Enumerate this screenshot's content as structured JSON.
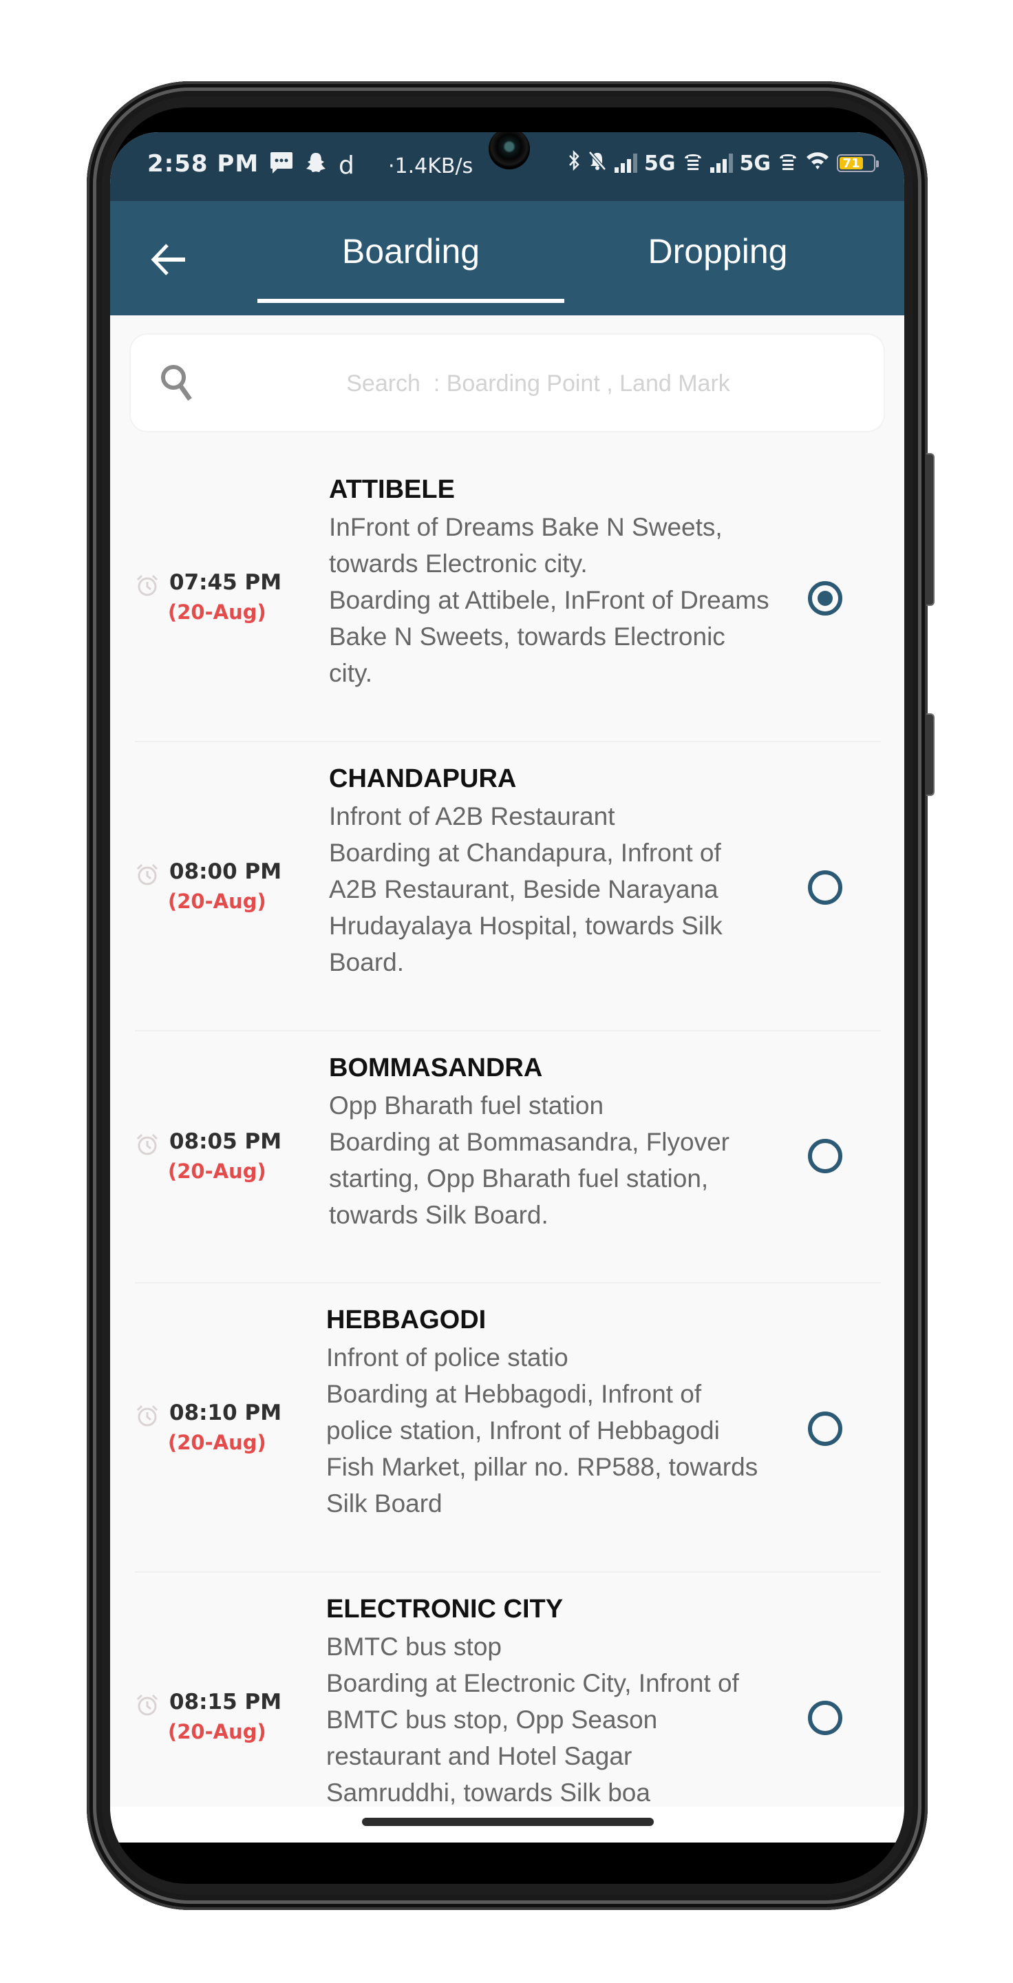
{
  "status_bar": {
    "time": "2:58 PM",
    "net_speed": "·1.4KB/s",
    "network_1": "5G",
    "network_2": "5G",
    "battery": "71",
    "icons": [
      "message-icon",
      "snapchat-icon",
      "d-app-icon",
      "bluetooth-icon",
      "mute-icon",
      "signal-icon",
      "volte-icon",
      "signal-icon",
      "volte-icon",
      "wifi-icon",
      "battery-icon"
    ]
  },
  "header": {
    "back_icon": "arrow-left-icon",
    "tabs": [
      {
        "label": "Boarding",
        "active": true
      },
      {
        "label": "Dropping",
        "active": false
      }
    ]
  },
  "search": {
    "icon": "search-icon",
    "placeholder": "Search  : Boarding Point , Land Mark",
    "value": ""
  },
  "points": [
    {
      "name": "ATTIBELE",
      "time": "07:45 PM",
      "date": "(20-Aug)",
      "address": "InFront of Dreams Bake N Sweets, towards Electronic city.",
      "details": "Boarding at Attibele, InFront of Dreams Bake N Sweets, towards Electronic city.",
      "selected": true
    },
    {
      "name": "CHANDAPURA",
      "time": "08:00 PM",
      "date": "(20-Aug)",
      "address": "Infront of A2B Restaurant",
      "details": "Boarding at Chandapura, Infront of A2B Restaurant, Beside Narayana Hrudayalaya Hospital, towards Silk Board.",
      "selected": false
    },
    {
      "name": "BOMMASANDRA",
      "time": "08:05 PM",
      "date": "(20-Aug)",
      "address": "Opp Bharath fuel station",
      "details": "Boarding at Bommasandra, Flyover starting, Opp Bharath fuel station, towards Silk Board.",
      "selected": false
    },
    {
      "name": "HEBBAGODI",
      "time": "08:10 PM",
      "date": "(20-Aug)",
      "address": "Infront of police statio",
      "details": "Boarding at Hebbagodi, Infront of police station, Infront of Hebbagodi Fish Market, pillar no. RP588, towards Silk Board",
      "selected": false
    },
    {
      "name": "ELECTRONIC CITY",
      "time": "08:15 PM",
      "date": "(20-Aug)",
      "address": "BMTC bus stop",
      "details": "Boarding at Electronic City, Infront of BMTC bus stop, Opp Season restaurant and Hotel Sagar Samruddhi, towards Silk boa",
      "selected": false
    }
  ],
  "colors": {
    "header_bg": "#2c5770",
    "status_bg": "#213f53",
    "accent": "#2c5a75",
    "date_red": "#e44b4b"
  }
}
